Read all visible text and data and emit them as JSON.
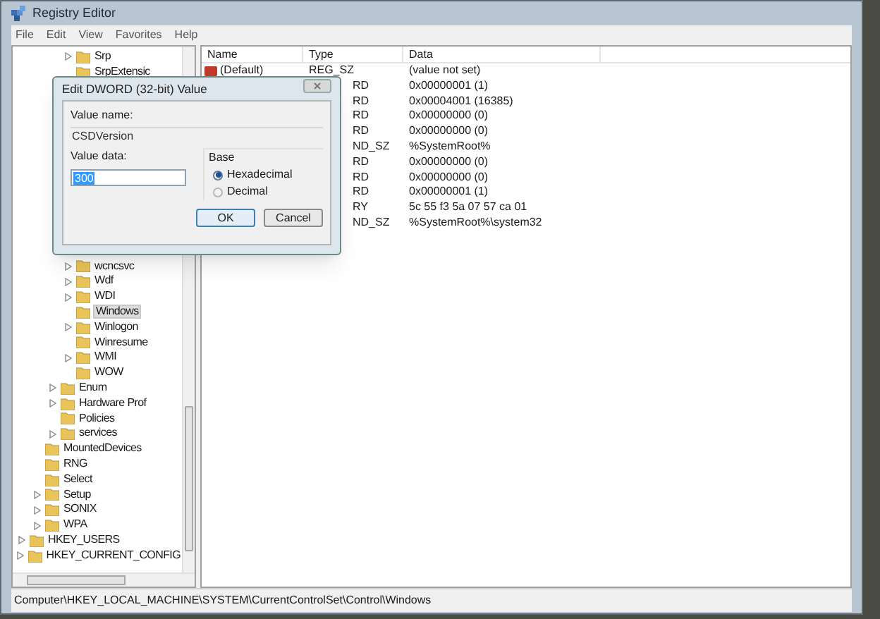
{
  "window": {
    "title": "Registry Editor"
  },
  "menu": [
    "File",
    "Edit",
    "View",
    "Favorites",
    "Help"
  ],
  "tree": [
    {
      "children": [
        {
          "children": [
            {
              "children": [
                {
                  "label": "Srp",
                  "expandable": true,
                  "selected": false
                },
                {
                  "label": "SrpExtensic",
                  "expandable": false,
                  "selected": false
                },
                {
                  "label": "wcncsvc",
                  "expandable": true,
                  "selected": false
                },
                {
                  "label": "Wdf",
                  "expandable": true,
                  "selected": false
                },
                {
                  "label": "WDI",
                  "expandable": true,
                  "selected": false
                },
                {
                  "label": "Windows",
                  "expandable": false,
                  "selected": true
                },
                {
                  "label": "Winlogon",
                  "expandable": true,
                  "selected": false
                },
                {
                  "label": "Winresume",
                  "expandable": false,
                  "selected": false
                },
                {
                  "label": "WMI",
                  "expandable": true,
                  "selected": false
                },
                {
                  "label": "WOW",
                  "expandable": false,
                  "selected": false
                }
              ]
            },
            {
              "label": "Enum",
              "expandable": true,
              "selected": false
            },
            {
              "label": "Hardware Prof",
              "expandable": true,
              "selected": false
            },
            {
              "label": "Policies",
              "expandable": false,
              "selected": false
            },
            {
              "label": "services",
              "expandable": true,
              "selected": false
            }
          ]
        },
        {
          "label": "MountedDevices",
          "expandable": false,
          "selected": false
        },
        {
          "label": "RNG",
          "expandable": false,
          "selected": false
        },
        {
          "label": "Select",
          "expandable": false,
          "selected": false
        },
        {
          "label": "Setup",
          "expandable": true,
          "selected": false
        },
        {
          "label": "SONIX",
          "expandable": true,
          "selected": false
        },
        {
          "label": "WPA",
          "expandable": true,
          "selected": false
        }
      ]
    },
    {
      "label": "HKEY_USERS",
      "expandable": true,
      "selected": false
    },
    {
      "label": "HKEY_CURRENT_CONFIG",
      "expandable": true,
      "selected": false
    }
  ],
  "table": {
    "columns": [
      "Name",
      "Type",
      "Data"
    ],
    "rows": [
      {
        "kind": "full",
        "name": "(Default)",
        "type": "REG_SZ",
        "data": "(value not set)"
      },
      {
        "kind": "covered",
        "type": "RD",
        "data": "0x00000001 (1)"
      },
      {
        "kind": "covered",
        "type": "RD",
        "data": "0x00004001 (16385)"
      },
      {
        "kind": "covered",
        "type": "RD",
        "data": "0x00000000 (0)"
      },
      {
        "kind": "covered",
        "type": "RD",
        "data": "0x00000000 (0)"
      },
      {
        "kind": "covered",
        "type": "ND_SZ",
        "data": "%SystemRoot%"
      },
      {
        "kind": "covered",
        "type": "RD",
        "data": "0x00000000 (0)"
      },
      {
        "kind": "covered",
        "type": "RD",
        "data": "0x00000000 (0)"
      },
      {
        "kind": "covered",
        "type": "RD",
        "data": "0x00000001 (1)"
      },
      {
        "kind": "covered",
        "type": "RY",
        "data": "5c 55 f3 5a 07 57 ca 01"
      },
      {
        "kind": "covered",
        "type": "ND_SZ",
        "data": "%SystemRoot%\\system32"
      }
    ]
  },
  "dialog": {
    "title": "Edit DWORD (32-bit) Value",
    "value_name_label": "Value name:",
    "value_name": "CSDVersion",
    "value_data_label": "Value data:",
    "value_data": "300",
    "base_label": "Base",
    "base_options": [
      {
        "label": "Hexadecimal",
        "selected": true
      },
      {
        "label": "Decimal",
        "selected": false
      }
    ],
    "buttons": [
      {
        "label": "OK",
        "default": true
      },
      {
        "label": "Cancel",
        "default": false
      }
    ]
  },
  "status_bar": "Computer\\HKEY_LOCAL_MACHINE\\SYSTEM\\CurrentControlSet\\Control\\Windows"
}
